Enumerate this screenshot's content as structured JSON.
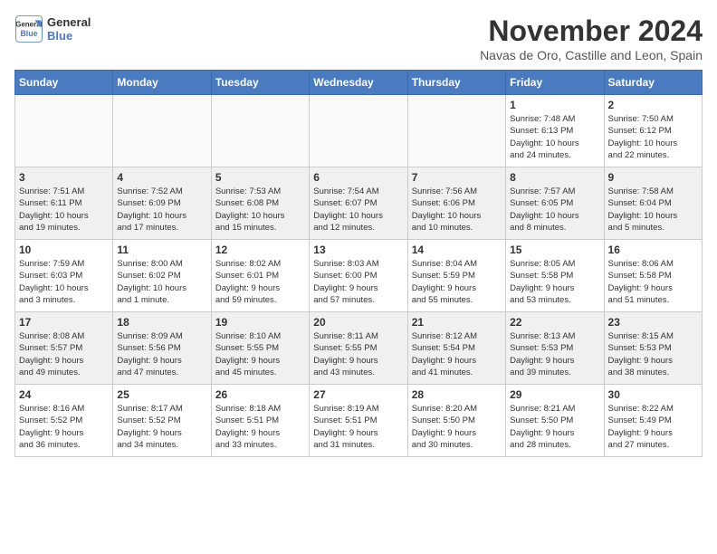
{
  "logo": {
    "line1": "General",
    "line2": "Blue"
  },
  "title": "November 2024",
  "location": "Navas de Oro, Castille and Leon, Spain",
  "weekdays": [
    "Sunday",
    "Monday",
    "Tuesday",
    "Wednesday",
    "Thursday",
    "Friday",
    "Saturday"
  ],
  "weeks": [
    [
      {
        "day": "",
        "info": ""
      },
      {
        "day": "",
        "info": ""
      },
      {
        "day": "",
        "info": ""
      },
      {
        "day": "",
        "info": ""
      },
      {
        "day": "",
        "info": ""
      },
      {
        "day": "1",
        "info": "Sunrise: 7:48 AM\nSunset: 6:13 PM\nDaylight: 10 hours\nand 24 minutes."
      },
      {
        "day": "2",
        "info": "Sunrise: 7:50 AM\nSunset: 6:12 PM\nDaylight: 10 hours\nand 22 minutes."
      }
    ],
    [
      {
        "day": "3",
        "info": "Sunrise: 7:51 AM\nSunset: 6:11 PM\nDaylight: 10 hours\nand 19 minutes."
      },
      {
        "day": "4",
        "info": "Sunrise: 7:52 AM\nSunset: 6:09 PM\nDaylight: 10 hours\nand 17 minutes."
      },
      {
        "day": "5",
        "info": "Sunrise: 7:53 AM\nSunset: 6:08 PM\nDaylight: 10 hours\nand 15 minutes."
      },
      {
        "day": "6",
        "info": "Sunrise: 7:54 AM\nSunset: 6:07 PM\nDaylight: 10 hours\nand 12 minutes."
      },
      {
        "day": "7",
        "info": "Sunrise: 7:56 AM\nSunset: 6:06 PM\nDaylight: 10 hours\nand 10 minutes."
      },
      {
        "day": "8",
        "info": "Sunrise: 7:57 AM\nSunset: 6:05 PM\nDaylight: 10 hours\nand 8 minutes."
      },
      {
        "day": "9",
        "info": "Sunrise: 7:58 AM\nSunset: 6:04 PM\nDaylight: 10 hours\nand 5 minutes."
      }
    ],
    [
      {
        "day": "10",
        "info": "Sunrise: 7:59 AM\nSunset: 6:03 PM\nDaylight: 10 hours\nand 3 minutes."
      },
      {
        "day": "11",
        "info": "Sunrise: 8:00 AM\nSunset: 6:02 PM\nDaylight: 10 hours\nand 1 minute."
      },
      {
        "day": "12",
        "info": "Sunrise: 8:02 AM\nSunset: 6:01 PM\nDaylight: 9 hours\nand 59 minutes."
      },
      {
        "day": "13",
        "info": "Sunrise: 8:03 AM\nSunset: 6:00 PM\nDaylight: 9 hours\nand 57 minutes."
      },
      {
        "day": "14",
        "info": "Sunrise: 8:04 AM\nSunset: 5:59 PM\nDaylight: 9 hours\nand 55 minutes."
      },
      {
        "day": "15",
        "info": "Sunrise: 8:05 AM\nSunset: 5:58 PM\nDaylight: 9 hours\nand 53 minutes."
      },
      {
        "day": "16",
        "info": "Sunrise: 8:06 AM\nSunset: 5:58 PM\nDaylight: 9 hours\nand 51 minutes."
      }
    ],
    [
      {
        "day": "17",
        "info": "Sunrise: 8:08 AM\nSunset: 5:57 PM\nDaylight: 9 hours\nand 49 minutes."
      },
      {
        "day": "18",
        "info": "Sunrise: 8:09 AM\nSunset: 5:56 PM\nDaylight: 9 hours\nand 47 minutes."
      },
      {
        "day": "19",
        "info": "Sunrise: 8:10 AM\nSunset: 5:55 PM\nDaylight: 9 hours\nand 45 minutes."
      },
      {
        "day": "20",
        "info": "Sunrise: 8:11 AM\nSunset: 5:55 PM\nDaylight: 9 hours\nand 43 minutes."
      },
      {
        "day": "21",
        "info": "Sunrise: 8:12 AM\nSunset: 5:54 PM\nDaylight: 9 hours\nand 41 minutes."
      },
      {
        "day": "22",
        "info": "Sunrise: 8:13 AM\nSunset: 5:53 PM\nDaylight: 9 hours\nand 39 minutes."
      },
      {
        "day": "23",
        "info": "Sunrise: 8:15 AM\nSunset: 5:53 PM\nDaylight: 9 hours\nand 38 minutes."
      }
    ],
    [
      {
        "day": "24",
        "info": "Sunrise: 8:16 AM\nSunset: 5:52 PM\nDaylight: 9 hours\nand 36 minutes."
      },
      {
        "day": "25",
        "info": "Sunrise: 8:17 AM\nSunset: 5:52 PM\nDaylight: 9 hours\nand 34 minutes."
      },
      {
        "day": "26",
        "info": "Sunrise: 8:18 AM\nSunset: 5:51 PM\nDaylight: 9 hours\nand 33 minutes."
      },
      {
        "day": "27",
        "info": "Sunrise: 8:19 AM\nSunset: 5:51 PM\nDaylight: 9 hours\nand 31 minutes."
      },
      {
        "day": "28",
        "info": "Sunrise: 8:20 AM\nSunset: 5:50 PM\nDaylight: 9 hours\nand 30 minutes."
      },
      {
        "day": "29",
        "info": "Sunrise: 8:21 AM\nSunset: 5:50 PM\nDaylight: 9 hours\nand 28 minutes."
      },
      {
        "day": "30",
        "info": "Sunrise: 8:22 AM\nSunset: 5:49 PM\nDaylight: 9 hours\nand 27 minutes."
      }
    ]
  ]
}
